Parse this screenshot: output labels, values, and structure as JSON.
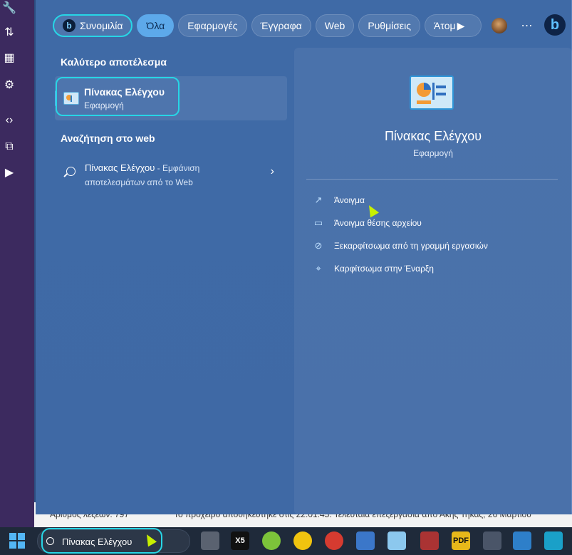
{
  "background_app": {
    "status_left": "Αριθμός λέξεων: 797",
    "status_right": "Το πρόχειρο αποθηκεύτηκε στις 22:01:45. Τελευταία επεξεργασία από Άκης Τηκάς, 26 Μαρτίου"
  },
  "tabs": {
    "copilot_label": "Συνομιλία",
    "items": [
      "Όλα",
      "Εφαρμογές",
      "Έγγραφα",
      "Web",
      "Ρυθμίσεις",
      "Άτομ"
    ]
  },
  "left_column": {
    "best_match_heading": "Καλύτερο αποτέλεσμα",
    "best_match": {
      "name": "Πίνακας Ελέγχου",
      "type": "Εφαρμογή"
    },
    "web_heading": "Αναζήτηση στο web",
    "web_result": {
      "title": "Πίνακας Ελέγχου",
      "suffix": " - Εμφάνιση αποτελεσμάτων από το Web"
    }
  },
  "detail": {
    "name": "Πίνακας Ελέγχου",
    "type": "Εφαρμογή",
    "actions": [
      {
        "label": "Άνοιγμα",
        "icon": "open-external-icon"
      },
      {
        "label": "Άνοιγμα θέσης αρχείου",
        "icon": "folder-icon"
      },
      {
        "label": "Ξεκαρφίτσωμα από τη γραμμή εργασιών",
        "icon": "unpin-icon"
      },
      {
        "label": "Καρφίτσωμα στην Έναρξη",
        "icon": "pin-icon"
      }
    ]
  },
  "taskbar": {
    "search_text": "Πίνακας Ελέγχου",
    "apps": [
      "task-view-icon",
      "x5-app-icon",
      "recycle-app-icon",
      "power-app-icon",
      "shutdown-app-icon",
      "network-app-icon",
      "control-panel-app-icon",
      "video-app-icon",
      "pdf-app-icon",
      "calculator-app-icon",
      "monitor-graph-app-icon",
      "desktop-app-icon"
    ],
    "x5_label": "X5",
    "pdf_label": "PDF"
  },
  "colors": {
    "panel": "#3f6aa6",
    "highlight": "#27d6e6",
    "active_tab": "#5da9ea",
    "taskbar": "#1f2a3a"
  }
}
